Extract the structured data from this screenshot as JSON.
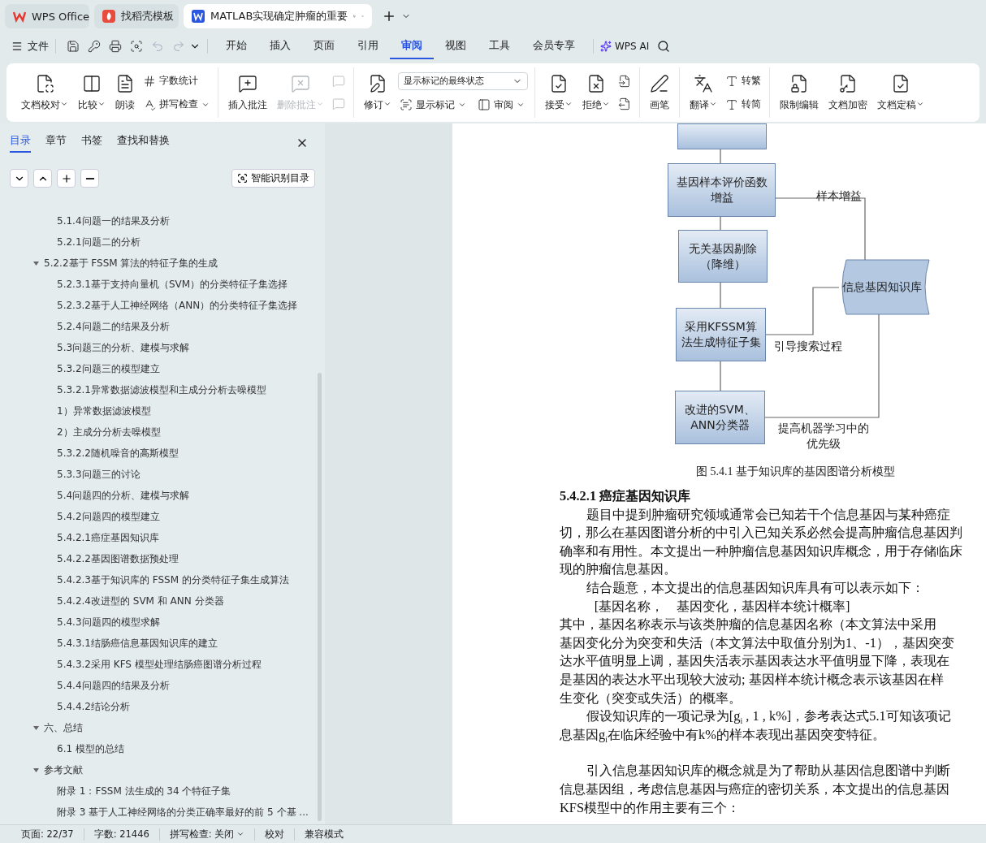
{
  "browser_tabs": [
    {
      "label": "WPS Office",
      "kind": "home",
      "selected": false
    },
    {
      "label": "找稻壳模板",
      "kind": "template",
      "selected": false
    },
    {
      "label": "MATLAB实现确定肿瘤的重要",
      "kind": "doc",
      "selected": true
    }
  ],
  "menu": {
    "file": "文件",
    "quick": [
      {
        "kind": "save",
        "disabled": false
      },
      {
        "kind": "key",
        "disabled": false
      },
      {
        "kind": "print",
        "disabled": false
      },
      {
        "kind": "preview",
        "disabled": false
      },
      {
        "kind": "undo",
        "disabled": true
      },
      {
        "kind": "redo",
        "disabled": true
      }
    ],
    "tabs": [
      {
        "label": "开始",
        "selected": false
      },
      {
        "label": "插入",
        "selected": false
      },
      {
        "label": "页面",
        "selected": false
      },
      {
        "label": "引用",
        "selected": false
      },
      {
        "label": "审阅",
        "selected": true
      },
      {
        "label": "视图",
        "selected": false
      },
      {
        "label": "工具",
        "selected": false
      },
      {
        "label": "会员专享",
        "selected": false
      }
    ],
    "ai": "WPS AI"
  },
  "ribbon": [
    {
      "items": [
        {
          "kind": "large",
          "label": "文档校对",
          "menu": true,
          "disabled": false
        },
        {
          "kind": "large",
          "label": "比较",
          "menu": true,
          "disabled": false
        },
        {
          "kind": "large",
          "label": "朗读",
          "menu": false,
          "disabled": false
        },
        {
          "kind": "stack",
          "items": [
            {
              "label": "字数统计",
              "menu": false,
              "disabled": false
            },
            {
              "label": "拼写检查",
              "menu": true,
              "disabled": false
            }
          ]
        }
      ]
    },
    {
      "items": [
        {
          "kind": "large",
          "label": "插入批注",
          "menu": false,
          "disabled": false
        },
        {
          "kind": "large",
          "label": "删除批注",
          "menu": true,
          "disabled": true
        },
        {
          "kind": "stack",
          "items": [
            {
              "menu": false,
              "disabled": true
            },
            {
              "menu": false,
              "disabled": true
            }
          ]
        }
      ]
    },
    {
      "items": [
        {
          "kind": "large",
          "label": "修订",
          "menu": true,
          "disabled": false
        },
        {
          "kind": "view",
          "value": "显示标记的最终状态",
          "items": [
            {
              "label": "显示标记",
              "menu": true,
              "disabled": false
            },
            {
              "label": "审阅",
              "menu": true,
              "disabled": false
            }
          ]
        }
      ]
    },
    {
      "items": [
        {
          "kind": "large",
          "label": "接受",
          "menu": true,
          "disabled": false
        },
        {
          "kind": "large",
          "label": "拒绝",
          "menu": true,
          "disabled": false
        },
        {
          "kind": "stack",
          "items": [
            {
              "menu": false,
              "disabled": false
            },
            {
              "menu": false,
              "disabled": false
            }
          ]
        }
      ]
    },
    {
      "items": [
        {
          "kind": "large",
          "label": "画笔",
          "menu": false,
          "disabled": false
        }
      ]
    },
    {
      "items": [
        {
          "kind": "large",
          "label": "翻译",
          "menu": true,
          "disabled": false
        },
        {
          "kind": "stack",
          "items": [
            {
              "label": "转繁",
              "menu": false,
              "disabled": false
            },
            {
              "label": "转简",
              "menu": false,
              "disabled": false
            }
          ]
        }
      ]
    },
    {
      "items": [
        {
          "kind": "large",
          "label": "限制编辑",
          "menu": false,
          "disabled": false
        },
        {
          "kind": "large",
          "label": "文档加密",
          "menu": false,
          "disabled": false
        },
        {
          "kind": "large",
          "label": "文档定稿",
          "menu": true,
          "disabled": false
        }
      ]
    }
  ],
  "sidebar": {
    "tabs": [
      {
        "label": "目录",
        "selected": true
      },
      {
        "label": "章节",
        "selected": false
      },
      {
        "label": "书签",
        "selected": false
      },
      {
        "label": "查找和替换",
        "selected": false
      }
    ],
    "smart_button": "智能识别目录",
    "toc": [
      {
        "label": "5.1.4问题一的结果及分析"
      },
      {
        "label": "5.2.1问题二的分析"
      },
      {
        "label": "5.2.2基于 FSSM 算法的特征子集的生成",
        "expanded": true,
        "children": [
          {
            "label": "5.2.3.1基于支持向量机（SVM）的分类特征子集选择"
          },
          {
            "label": "5.2.3.2基于人工神经网络（ANN）的分类特征子集选择"
          }
        ]
      },
      {
        "label": "5.2.4问题二的结果及分析"
      },
      {
        "label": "5.3问题三的分析、建模与求解"
      },
      {
        "label": "5.3.2问题三的模型建立"
      },
      {
        "label": "5.3.2.1异常数据滤波模型和主成分分析去噪模型"
      },
      {
        "label": "1）异常数据滤波模型"
      },
      {
        "label": "2）主成分分析去噪模型"
      },
      {
        "label": "5.3.2.2随机噪音的高斯模型"
      },
      {
        "label": "5.3.3问题三的讨论"
      },
      {
        "label": "5.4问题四的分析、建模与求解"
      },
      {
        "label": "5.4.2问题四的模型建立"
      },
      {
        "label": "5.4.2.1癌症基因知识库"
      },
      {
        "label": "5.4.2.2基因图谱数据预处理"
      },
      {
        "label": "5.4.2.3基于知识库的 FSSM 的分类特征子集生成算法"
      },
      {
        "label": "5.4.2.4改进型的 SVM 和 ANN 分类器"
      },
      {
        "label": "5.4.3问题四的模型求解"
      },
      {
        "label": "5.4.3.1结肠癌信息基因知识库的建立"
      },
      {
        "label": "5.4.3.2采用 KFS 模型处理结肠癌图谱分析过程"
      },
      {
        "label": "5.4.4问题四的结果及分析"
      },
      {
        "label": "5.4.4.2结论分析"
      },
      {
        "label": "六、总结",
        "expanded": true,
        "children": [
          {
            "label": "6.1 模型的总结"
          }
        ]
      },
      {
        "label": "参考文献",
        "expanded": true,
        "children": [
          {
            "label": "附录 1：FSSM 法生成的 34 个特征子集"
          },
          {
            "label": "附录 3 基于人工神经网络的分类正确率最好的前 5 个基 ..."
          }
        ]
      }
    ]
  },
  "document": {
    "diagram": {
      "boxes": [
        {
          "lines": [
            "基因样本评价函数",
            "增益"
          ]
        },
        {
          "lines": [
            "无关基因剔除",
            "（降维）"
          ]
        },
        {
          "lines": [
            "采用KFSSM算",
            "法生成特征子集"
          ]
        },
        {
          "lines": [
            "改进的SVM、",
            "ANN分类器"
          ]
        }
      ],
      "database": "信息基因知识库",
      "edge_labels": [
        {
          "lines": [
            "样本增益"
          ]
        },
        {
          "lines": [
            "引导搜索过程"
          ]
        },
        {
          "lines": [
            "提高机器学习中的",
            "优先级"
          ]
        }
      ]
    },
    "caption": "图  5.4.1 基于知识库的基因图谱分析模型",
    "heading": "5.4.2.1  癌症基因知识库",
    "paragraphs": [
      {
        "kind": "body",
        "space_before": false,
        "lines": [
          "题目中提到肿瘤研究领域通常会已知若干个信息基因与某种癌症",
          "切，那么在基因图谱分析的中引入已知关系必然会提高肿瘤信息基因判",
          "确率和有用性。本文提出一种肿瘤信息基因知识库概念，用于存储临床",
          "现的肿瘤信息基因。"
        ]
      },
      {
        "kind": "body",
        "space_before": false,
        "lines": [
          "结合题意，本文提出的信息基因知识库具有可以表示如下："
        ]
      },
      {
        "kind": "formula",
        "space_before": false,
        "lines": [
          "[基因名称，　基因变化，基因样本统计概率]"
        ]
      },
      {
        "kind": "flush",
        "space_before": false,
        "lines": [
          "其中，基因名称表示与该类肿瘤的信息基因名称（本文算法中采用",
          "基因变化分为突变和失活（本文算法中取值分别为1、-1），基因突变",
          "达水平值明显上调，基因失活表示基因表达水平值明显下降，表现在",
          "是基因的表达水平出现较大波动; 基因样本统计概念表示该基因在样",
          "生变化（突变或失活）的概率。"
        ]
      },
      {
        "kind": "body",
        "space_before": false,
        "lines": [
          "假设知识库的一项记录为[g$_{i}$ , 1 , k%]，参考表达式5.1可知该项记",
          "息基因g$_{i}$在临床经验中有k%的样本表现出基因突变特征。"
        ]
      },
      {
        "kind": "body",
        "space_before": true,
        "lines": [
          "引入信息基因知识库的概念就是为了帮助从基因信息图谱中判断",
          "信息基因组，考虑信息基因与癌症的密切关系，本文提出的信息基因",
          "KFS模型中的作用主要有三个："
        ]
      }
    ]
  },
  "status_bar": [
    {
      "label": "页面: 22/37",
      "menu": false
    },
    {
      "label": "字数: 21446",
      "menu": false
    },
    {
      "label": "拼写检查: 关闭",
      "menu": true
    },
    {
      "label": "校对",
      "menu": false
    },
    {
      "label": "兼容模式",
      "menu": false
    }
  ]
}
